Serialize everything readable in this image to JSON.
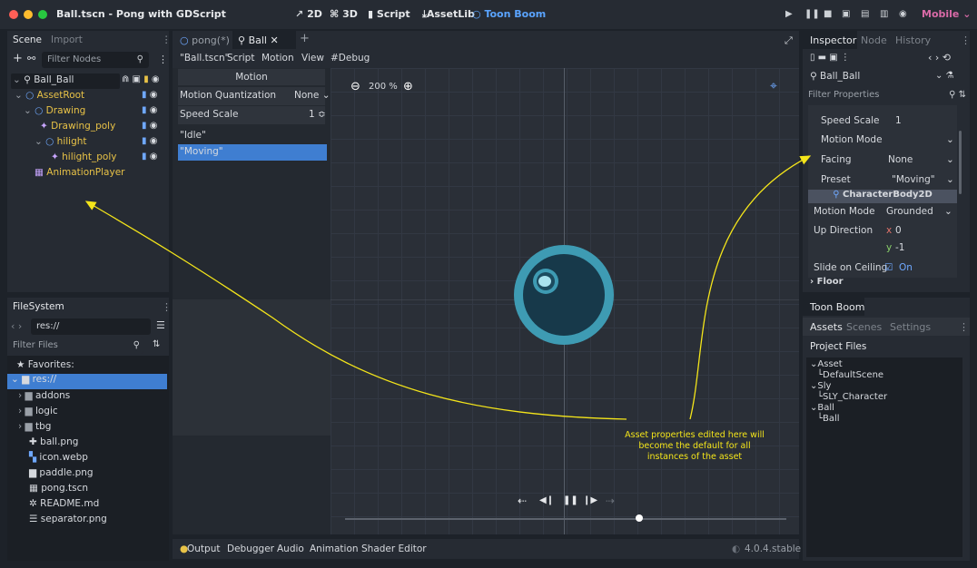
{
  "window": {
    "title": "Ball.tscn - Pong with GDScript"
  },
  "main_bar": {
    "btn_2d": "2D",
    "btn_3d": "3D",
    "btn_script": "Script",
    "btn_assetlib": "AssetLib",
    "btn_toonboom": "Toon Boom",
    "renderer": "Mobile"
  },
  "scene_panel": {
    "tab_scene": "Scene",
    "tab_import": "Import",
    "filter_placeholder": "Filter Nodes",
    "nodes": [
      {
        "label": "Ball_Ball"
      },
      {
        "label": "AssetRoot"
      },
      {
        "label": "Drawing"
      },
      {
        "label": "Drawing_poly"
      },
      {
        "label": "hilight"
      },
      {
        "label": "hilight_poly"
      },
      {
        "label": "AnimationPlayer"
      }
    ]
  },
  "filesystem": {
    "title": "FileSystem",
    "path": "res://",
    "filter_placeholder": "Filter Files",
    "favorites": "Favorites:",
    "items": [
      "res://",
      "addons",
      "logic",
      "tbg",
      "ball.png",
      "icon.webp",
      "paddle.png",
      "pong.tscn",
      "README.md",
      "separator.png"
    ]
  },
  "editor_tabs": {
    "tab1": "pong(*)",
    "tab2": "Ball"
  },
  "scene_menu": {
    "file": "\"Ball.tscn\"",
    "script": "Script",
    "motion": "Motion",
    "view": "View",
    "debug": "#Debug"
  },
  "motion_panel": {
    "header": "Motion",
    "quant_label": "Motion Quantization",
    "quant_value": "None",
    "speed_label": "Speed Scale",
    "speed_value": "1",
    "anims": [
      "\"Idle\"",
      "\"Moving\""
    ]
  },
  "viewport": {
    "zoom": "200 %"
  },
  "inspector": {
    "tab_inspector": "Inspector",
    "tab_node": "Node",
    "tab_history": "History",
    "object": "Ball_Ball",
    "filter_placeholder": "Filter Properties",
    "speed_scale_label": "Speed Scale",
    "speed_scale_value": "1",
    "motion_mode_label": "Motion Mode",
    "facing_label": "Facing",
    "facing_value": "None",
    "preset_label": "Preset",
    "preset_value": "\"Moving\"",
    "section": "CharacterBody2D",
    "cb_motion_mode_label": "Motion Mode",
    "cb_motion_mode_value": "Grounded",
    "up_dir_label": "Up Direction",
    "up_x_label": "x",
    "up_x": "0",
    "up_y_label": "y",
    "up_y": "-1",
    "slide_label": "Slide on Ceiling",
    "slide_value": "On",
    "floor": "Floor"
  },
  "toonboom": {
    "title": "Toon Boom",
    "tab_assets": "Assets",
    "tab_scenes": "Scenes",
    "tab_settings": "Settings",
    "project_files": "Project Files",
    "tree": [
      "Asset",
      "DefaultScene",
      "Sly",
      "SLY_Character",
      "Ball",
      "Ball"
    ]
  },
  "bottom": {
    "output": "Output",
    "debugger": "Debugger",
    "audio": "Audio",
    "animation": "Animation",
    "shader": "Shader Editor",
    "version": "4.0.4.stable"
  },
  "annotation": {
    "text": "Asset properties edited here will become the default for all instances of the asset"
  },
  "colors": {
    "accent": "#3f7ed1",
    "node_yellow": "#e8c247",
    "annotation": "#f4e51a",
    "ball_outer": "#3e9bb3",
    "ball_inner": "#17394a"
  }
}
